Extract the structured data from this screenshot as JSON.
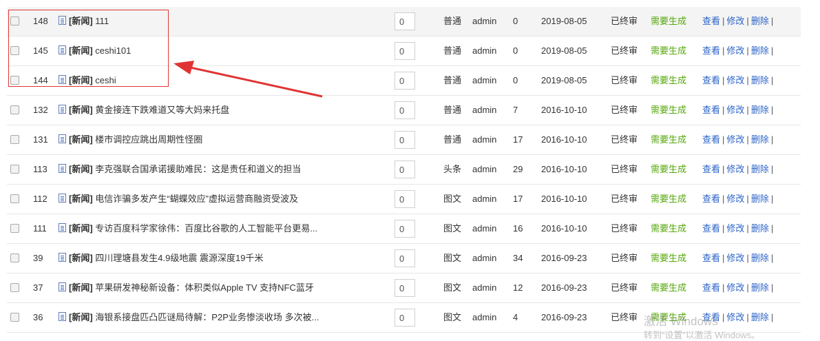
{
  "list": {
    "category_label": "[新闻]",
    "actions": {
      "view": "查看",
      "edit": "修改",
      "delete": "删除",
      "separator": "|"
    },
    "rows": [
      {
        "id": "148",
        "title": "111",
        "sort": "0",
        "type": "普通",
        "user": "admin",
        "hits": "0",
        "date": "2019-08-05",
        "audit": "已终审",
        "gen": "需要生成"
      },
      {
        "id": "145",
        "title": "ceshi101",
        "sort": "0",
        "type": "普通",
        "user": "admin",
        "hits": "0",
        "date": "2019-08-05",
        "audit": "已终审",
        "gen": "需要生成"
      },
      {
        "id": "144",
        "title": "ceshi",
        "sort": "0",
        "type": "普通",
        "user": "admin",
        "hits": "0",
        "date": "2019-08-05",
        "audit": "已终审",
        "gen": "需要生成"
      },
      {
        "id": "132",
        "title": "黄金接连下跌难道又等大妈来托盘",
        "sort": "0",
        "type": "普通",
        "user": "admin",
        "hits": "7",
        "date": "2016-10-10",
        "audit": "已终审",
        "gen": "需要生成"
      },
      {
        "id": "131",
        "title": "楼市调控应跳出周期性怪圈",
        "sort": "0",
        "type": "普通",
        "user": "admin",
        "hits": "17",
        "date": "2016-10-10",
        "audit": "已终审",
        "gen": "需要生成"
      },
      {
        "id": "113",
        "title": "李克强联合国承诺援助难民：这是责任和道义的担当",
        "sort": "0",
        "type": "头条",
        "user": "admin",
        "hits": "29",
        "date": "2016-10-10",
        "audit": "已终审",
        "gen": "需要生成"
      },
      {
        "id": "112",
        "title": "电信诈骗多发产生“蝴蝶效应”虚拟运营商融资受波及",
        "sort": "0",
        "type": "图文",
        "user": "admin",
        "hits": "17",
        "date": "2016-10-10",
        "audit": "已终审",
        "gen": "需要生成"
      },
      {
        "id": "111",
        "title": "专访百度科学家徐伟：百度比谷歌的人工智能平台更易...",
        "sort": "0",
        "type": "图文",
        "user": "admin",
        "hits": "16",
        "date": "2016-10-10",
        "audit": "已终审",
        "gen": "需要生成"
      },
      {
        "id": "39",
        "title": "四川理塘县发生4.9级地震 震源深度19千米",
        "sort": "0",
        "type": "图文",
        "user": "admin",
        "hits": "34",
        "date": "2016-09-23",
        "audit": "已终审",
        "gen": "需要生成"
      },
      {
        "id": "37",
        "title": "苹果研发神秘新设备：体积类似Apple TV 支持NFC蓝牙",
        "sort": "0",
        "type": "图文",
        "user": "admin",
        "hits": "12",
        "date": "2016-09-23",
        "audit": "已终审",
        "gen": "需要生成"
      },
      {
        "id": "36",
        "title": "海银系接盘匹凸匹谜局待解：P2P业务惨淡收场 多次被...",
        "sort": "0",
        "type": "图文",
        "user": "admin",
        "hits": "4",
        "date": "2016-09-23",
        "audit": "已终审",
        "gen": "需要生成"
      }
    ]
  },
  "watermark": {
    "line1": "激活 Windows",
    "line2": "转到“设置”以激活 Windows。"
  },
  "colors": {
    "annotation": "#e03434",
    "link": "#2b63c8",
    "gen_status": "#55a70b"
  }
}
